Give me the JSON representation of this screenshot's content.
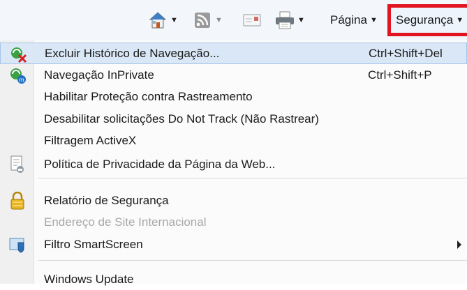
{
  "toolbar": {
    "icons": [
      "home-icon",
      "rss-feed-icon",
      "mail-icon",
      "print-icon"
    ],
    "pagina_label": "Página",
    "seguranca_label": "Segurança",
    "highlight_color": "#e0151f"
  },
  "menu": {
    "items": [
      {
        "label": "Excluir Histórico de Navegação...",
        "shortcut": "Ctrl+Shift+Del",
        "icon": "delete-history-icon"
      },
      {
        "label": "Navegação InPrivate",
        "shortcut": "Ctrl+Shift+P",
        "icon": "inprivate-icon"
      },
      {
        "label": "Habilitar Proteção contra Rastreamento"
      },
      {
        "label": "Desabilitar solicitações Do Not Track (Não Rastrear)"
      },
      {
        "label": "Filtragem ActiveX"
      },
      {
        "label": "Política de Privacidade da Página da Web...",
        "icon": "privacy-policy-icon"
      },
      {
        "label": "Relatório de Segurança",
        "icon": "lock-icon"
      },
      {
        "label": "Endereço de Site Internacional",
        "disabled": true
      },
      {
        "label": "Filtro SmartScreen",
        "icon": "smartscreen-icon",
        "submenu": true
      },
      {
        "label": "Windows Update"
      }
    ]
  }
}
